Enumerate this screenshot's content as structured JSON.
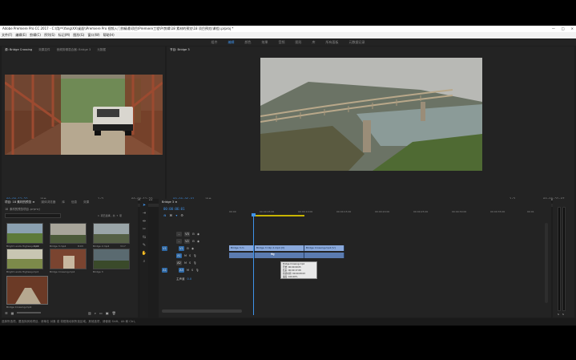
{
  "window": {
    "title": "Adobe Premiere Pro CC 2017 - C:\\用户\\Yang\\XX\\桌面\\\\Premiere Pro 视频入门到精通\\项目\\Premiere工程\\Pr剪辑\\18 素材的预览\\18 项目预览(课程).prproj *",
    "minimize": "—",
    "maximize": "□",
    "close": "×"
  },
  "menu": [
    "文件(F)",
    "编辑(E)",
    "剪辑(C)",
    "序列(S)",
    "标记(M)",
    "图形(G)",
    "窗口(W)",
    "帮助(H)"
  ],
  "workspaces": [
    "组件",
    "编辑",
    "颜色",
    "效果",
    "音频",
    "图形",
    "库",
    "所有面板",
    "元数据记录"
  ],
  "active_workspace": "编辑",
  "source_monitor": {
    "tabs": [
      "源: Bridge Crossing",
      "效果控件",
      "音频剪辑混合器: Bridge 3",
      "元数据"
    ],
    "timecode_in": "00:00:13:23",
    "fit": "适合",
    "fraction": "1/2",
    "timecode_out": "00:00:11:22"
  },
  "program_monitor": {
    "tabs": [
      "节目: Bridge 3"
    ],
    "timecode_in": "00:00:06:01",
    "fit": "适合",
    "fraction": "1/2",
    "timecode_out": "00:00:23:07"
  },
  "transport": [
    "▾",
    "{",
    "}",
    "|←",
    "◀|",
    "▶",
    "|▶",
    "→|",
    "⇲",
    "⇱",
    "📷",
    "+"
  ],
  "project": {
    "tabs": [
      "项目: 18 素材的预览 ≡",
      "媒体浏览器",
      "库",
      "信息",
      "效果"
    ],
    "path": "18 素材的预览项目.prproj",
    "search_placeholder": "",
    "count": "1 项已选择，共 7 项",
    "items": [
      {
        "label": "Bright Lands Highway.mp4",
        "duration": "6:00"
      },
      {
        "label": "Bridge 3.mp4",
        "duration": "8:03"
      },
      {
        "label": "Bridge 2.mp4",
        "duration": "3:17"
      },
      {
        "label": "Bright Lands Highway.mp4",
        "duration": ""
      },
      {
        "label": "Bridge Crossing.mp4",
        "duration": ""
      },
      {
        "label": "Bridge 3",
        "duration": ""
      },
      {
        "label": "Bridge Crossing.mp4",
        "duration": ""
      }
    ]
  },
  "timeline": {
    "tab": "Bridge 3 ≡",
    "timecode": "00:00:06:01",
    "ruler_ticks": [
      "00:00",
      "00:00:05:00",
      "00:00:10:00",
      "00:00:15:00",
      "00:00:20:00",
      "00:00:25:00",
      "00:00:30:00",
      "00:00:35:00",
      "00:00:40:00",
      "00:00:45:00",
      "00:01"
    ],
    "tracks": [
      {
        "name": "V3"
      },
      {
        "name": "V2"
      },
      {
        "name": "V1"
      },
      {
        "name": "A1"
      },
      {
        "name": "A2"
      },
      {
        "name": "A3"
      }
    ],
    "video_clips": [
      "Bridge 3.m",
      "Bridge 3 Clip 2.mp4 [V]",
      "Bridge Crossing.mp4 [V]"
    ],
    "tooltip_lines": [
      "Bridge Crossing.mp4",
      "开始: 00:00:09:05",
      "结束: 00:00:17:08",
      "持续时间: 00:00:08:03",
      "速度: 100.00%"
    ],
    "master": "0.0"
  },
  "meter_labels": [
    "0",
    "-6",
    "-12",
    "-18",
    "-24",
    "-30",
    "-36",
    "-42",
    "-48",
    "-54",
    "dB"
  ],
  "status": "选择所选项。要选择其他项目，请单击 对象 或 将框拖动到所选区域。其他选项，请使用 Shift、Alt 和 Ctrl。",
  "colors": {
    "accent": "#3f93ea",
    "panel": "#232323",
    "clip_video": "#8aa9dc",
    "clip_audio": "#5b7bb0"
  }
}
